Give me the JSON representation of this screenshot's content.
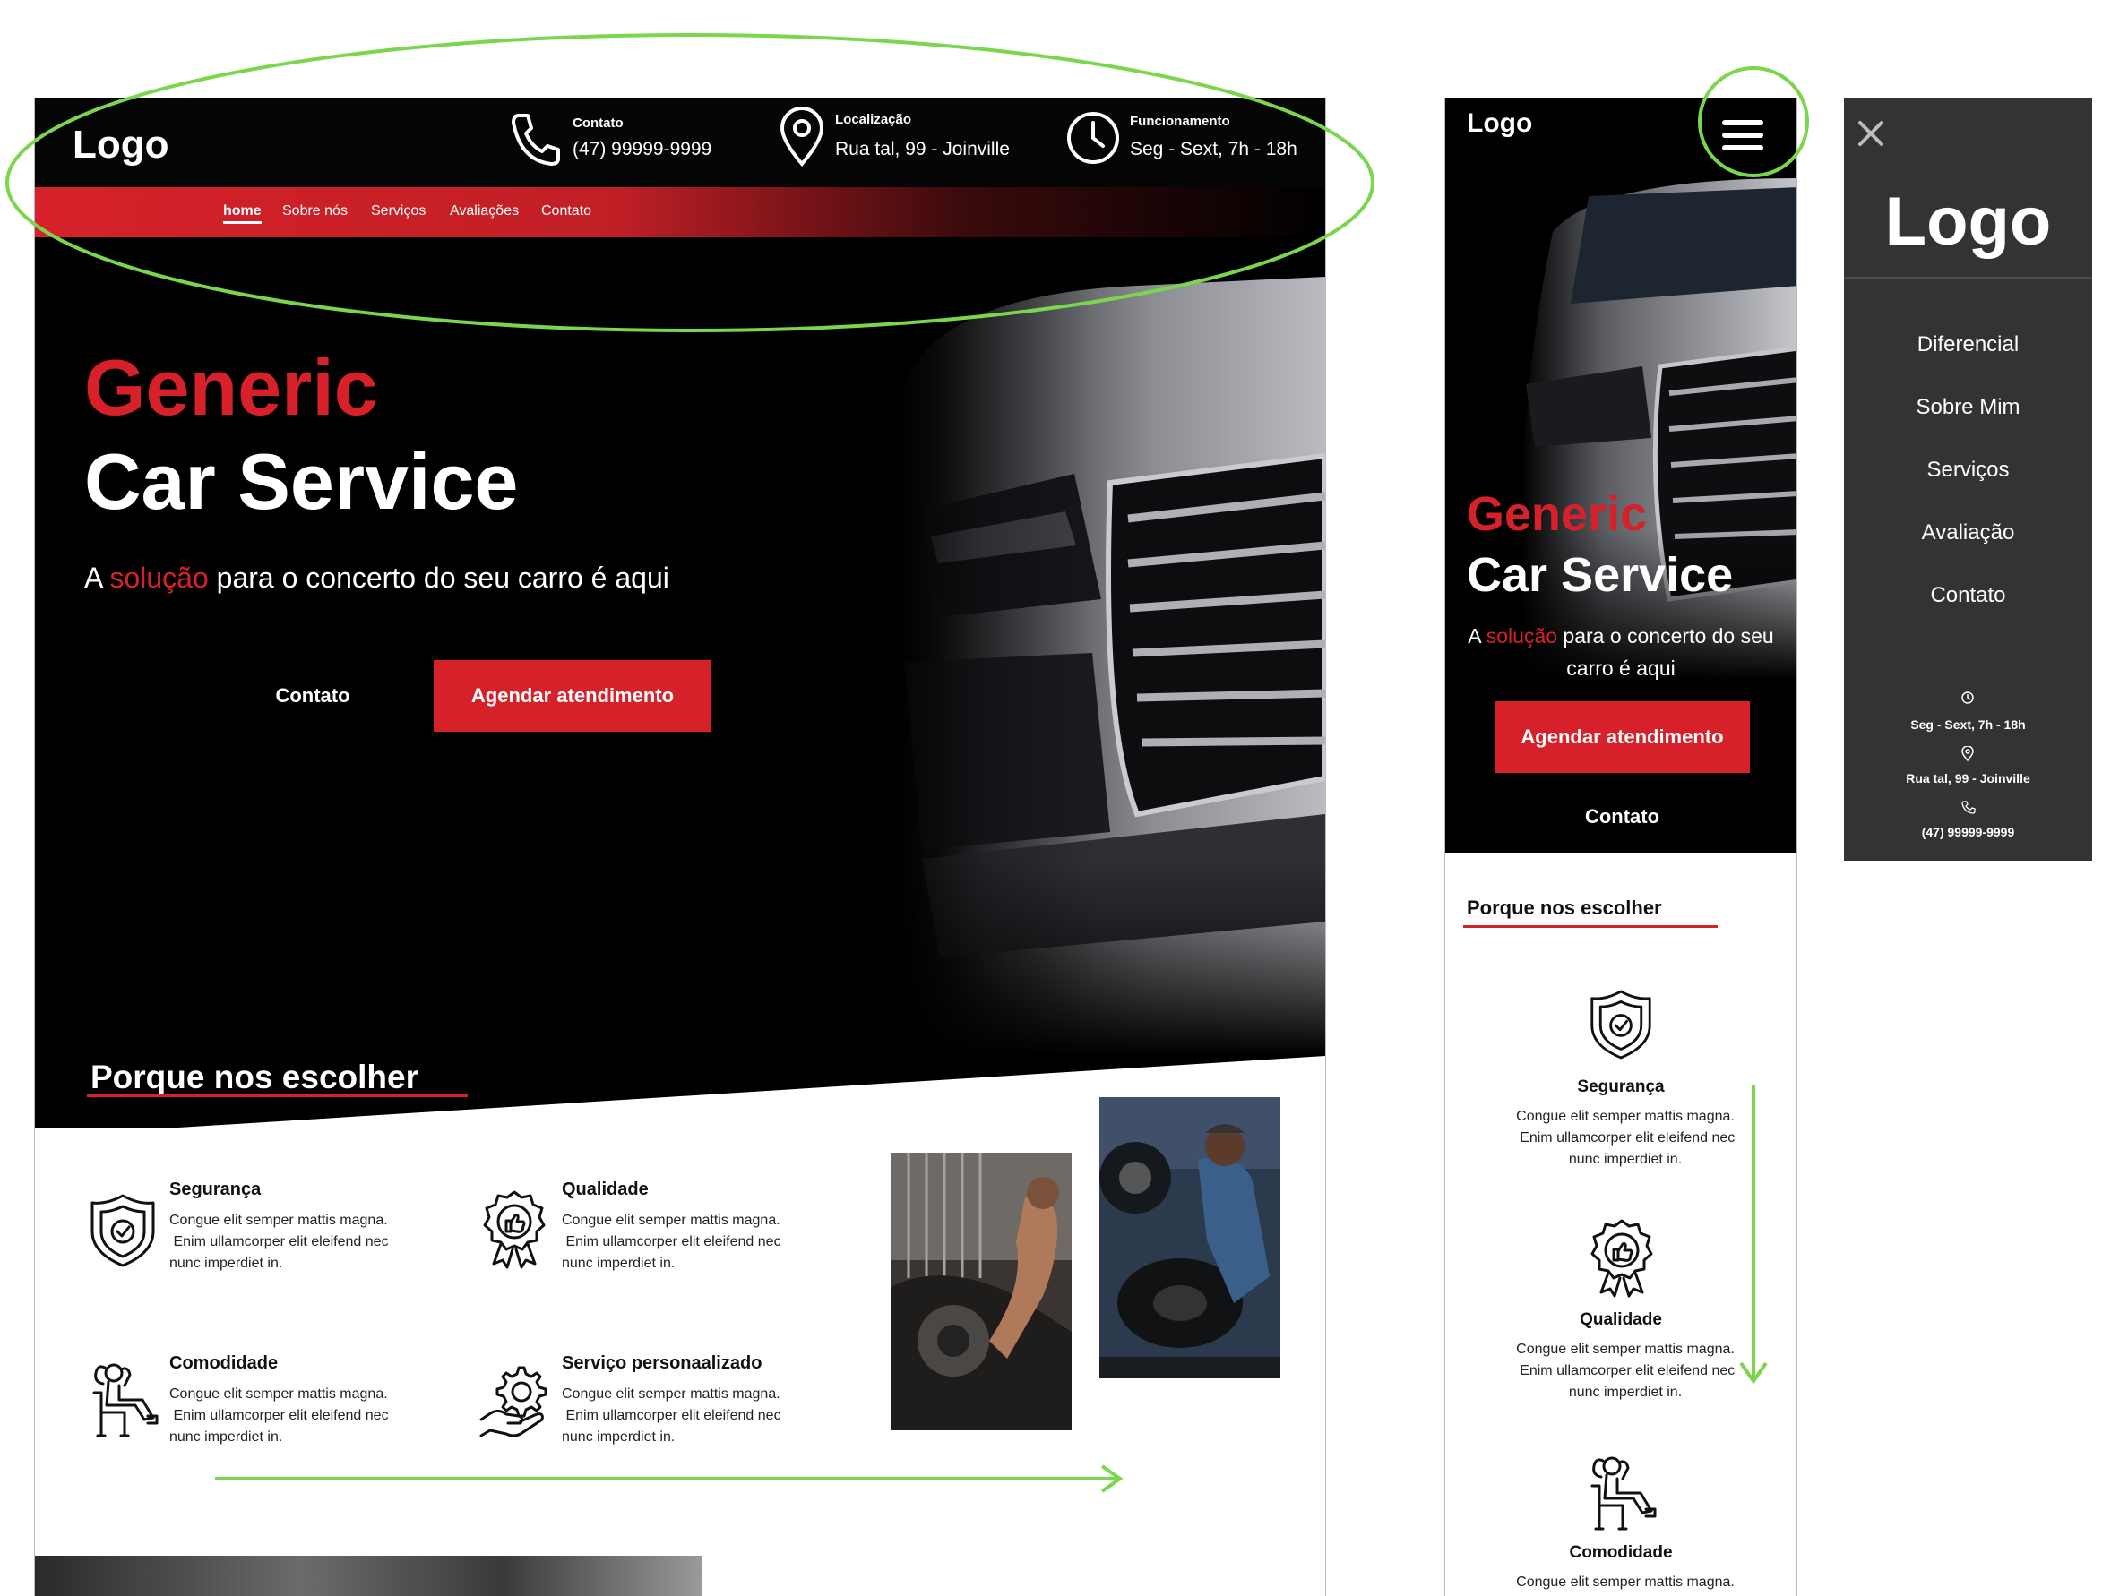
{
  "brand": {
    "logo": "Logo"
  },
  "desktop": {
    "contact": {
      "label": "Contato",
      "value": "(47) 99999-9999"
    },
    "location": {
      "label": "Localização",
      "value": "Rua tal, 99 - Joinville"
    },
    "hours": {
      "label": "Funcionamento",
      "value": "Seg - Sext, 7h - 18h"
    },
    "nav": [
      "home",
      "Sobre nós",
      "Serviços",
      "Avaliações",
      "Contato"
    ],
    "hero": {
      "title_red": "Generic",
      "title_white": "Car Service",
      "sub_pre": "A ",
      "sub_red": "solução",
      "sub_post": " para o concerto do seu carro é aqui",
      "contato_button": "Contato",
      "agendar_button": "Agendar atendimento"
    },
    "why": {
      "title": "Porque nos escolher",
      "features": [
        {
          "title": "Segurança",
          "desc1": "Congue elit semper mattis magna.",
          "desc2": " Enim ullamcorper elit eleifend nec",
          "desc3": "nunc imperdiet in."
        },
        {
          "title": "Qualidade",
          "desc1": "Congue elit semper mattis magna.",
          "desc2": " Enim ullamcorper elit eleifend nec",
          "desc3": "nunc imperdiet in."
        },
        {
          "title": "Comodidade",
          "desc1": "Congue elit semper mattis magna.",
          "desc2": " Enim ullamcorper elit eleifend nec",
          "desc3": "nunc imperdiet in."
        },
        {
          "title": "Serviço personaalizado",
          "desc1": "Congue elit semper mattis magna.",
          "desc2": " Enim ullamcorper elit eleifend nec",
          "desc3": "nunc imperdiet in."
        }
      ]
    }
  },
  "mobile": {
    "hero": {
      "title_red": "Generic",
      "title_white": "Car Service",
      "sub_pre": "A ",
      "sub_red": "solução",
      "sub_post": " para o concerto do seu carro é aqui",
      "agendar_button": "Agendar atendimento",
      "contato_button": "Contato"
    },
    "why": {
      "title": "Porque nos escolher",
      "features": [
        {
          "title": "Segurança",
          "desc1": "Congue elit semper mattis magna.",
          "desc2": " Enim ullamcorper elit eleifend nec",
          "desc3": "nunc imperdiet in."
        },
        {
          "title": "Qualidade",
          "desc1": "Congue elit semper mattis magna.",
          "desc2": " Enim ullamcorper elit eleifend nec",
          "desc3": "nunc imperdiet in."
        },
        {
          "title": "Comodidade",
          "desc1": "Congue elit semper mattis magna."
        }
      ]
    }
  },
  "sidemenu": {
    "items": [
      "Diferencial",
      "Sobre Mim",
      "Serviços",
      "Avaliação",
      "Contato"
    ],
    "hours": "Seg - Sext, 7h - 18h",
    "address": "Rua tal, 99 - Joinville",
    "phone": "(47) 99999-9999"
  },
  "colors": {
    "accent_red": "#d6212a",
    "annotation_green": "#7bd64d",
    "side_menu_bg": "#333333"
  }
}
